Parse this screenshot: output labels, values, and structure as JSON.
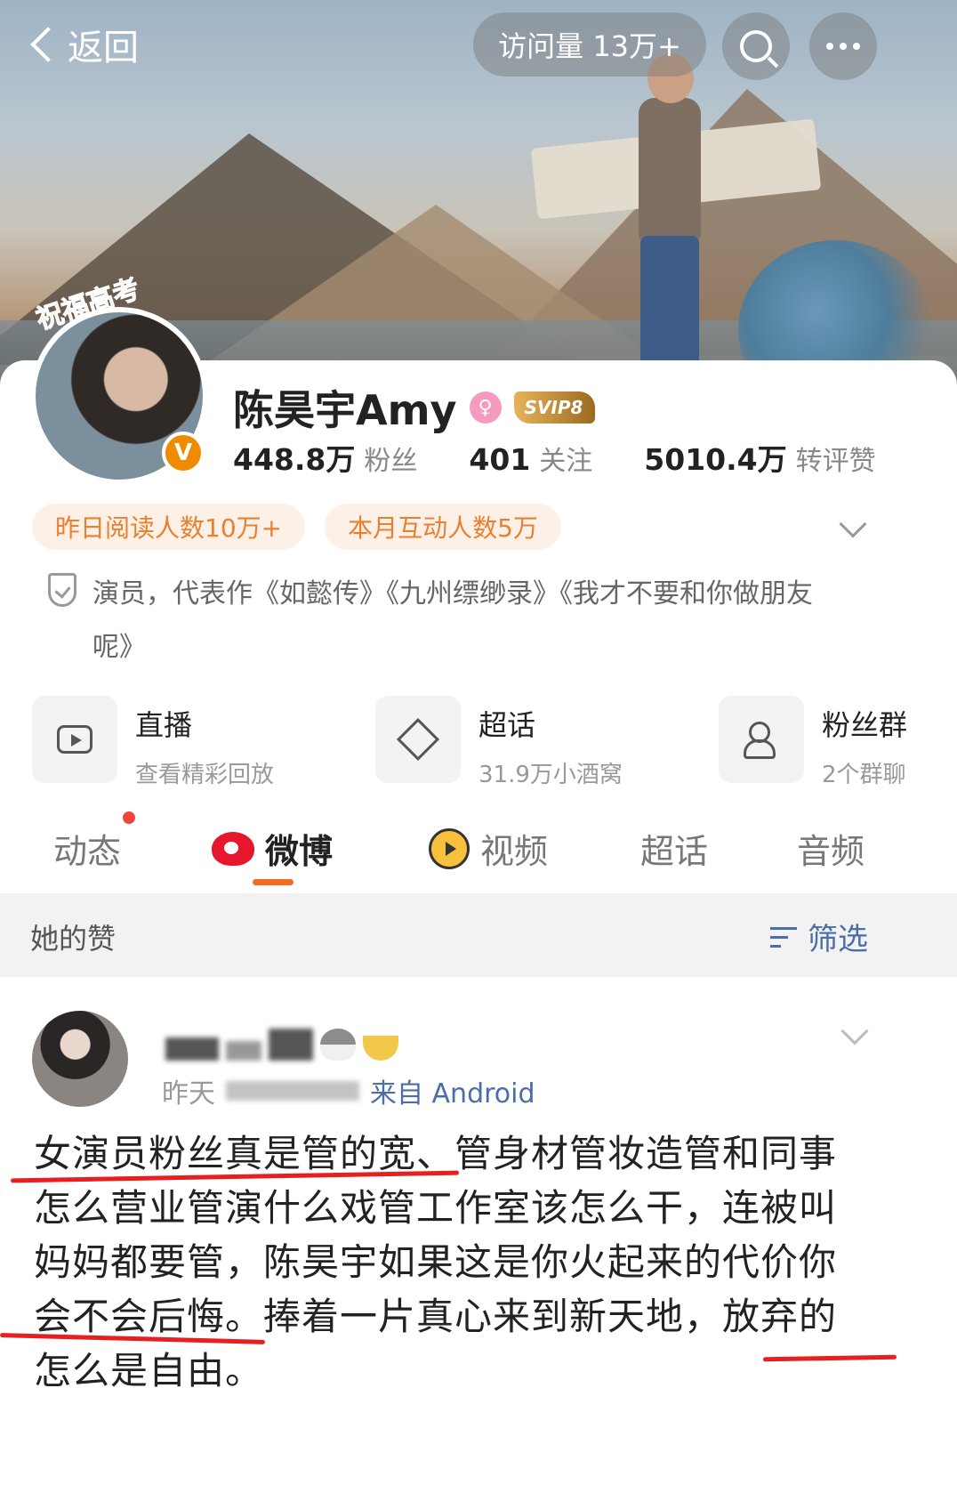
{
  "header": {
    "back_label": "返回",
    "visits": "访问量 13万+",
    "icons": [
      "chevron-left-icon",
      "search-icon",
      "more-icon"
    ]
  },
  "profile": {
    "avatar_badge": "祝福高考",
    "verified_badge": "V",
    "name": "陈昊宇Amy",
    "gender_symbol": "♀",
    "vip_badge": "SVIP8",
    "stats": [
      {
        "num": "448.8万",
        "label": "粉丝"
      },
      {
        "num": "401",
        "label": "关注"
      },
      {
        "num": "5010.4万",
        "label": "转评赞"
      }
    ],
    "tags": [
      "昨日阅读人数10万+",
      "本月互动人数5万"
    ],
    "bio": "演员，代表作《如懿传》《九州缥缈录》《我才不要和你做朋友呢》"
  },
  "entries": [
    {
      "title": "直播",
      "sub": "查看精彩回放",
      "icon": "live-tv-icon"
    },
    {
      "title": "超话",
      "sub": "31.9万小酒窝",
      "icon": "diamond-icon"
    },
    {
      "title": "粉丝群",
      "sub": "2个群聊",
      "icon": "people-icon"
    }
  ],
  "tabs": [
    {
      "label": "动态",
      "active": false,
      "dot": true
    },
    {
      "label": "微博",
      "active": true,
      "icon": "weibo-icon"
    },
    {
      "label": "视频",
      "active": false,
      "icon": "video-icon"
    },
    {
      "label": "超话",
      "active": false
    },
    {
      "label": "音频",
      "active": false
    }
  ],
  "filter_bar": {
    "label": "她的赞",
    "filter_label": "筛选"
  },
  "post": {
    "time": "昨天",
    "source": "来自 Android",
    "lines": [
      "女演员粉丝真是管的宽、管身材管妆造管和同事",
      "怎么营业管演什么戏管工作室该怎么干，连被叫",
      "妈妈都要管，陈昊宇如果这是你火起来的代价你",
      "会不会后悔。捧着一片真心来到新天地，放弃的",
      "怎么是自由。"
    ]
  },
  "colors": {
    "accent": "#f26d20",
    "link": "#4b6ea8",
    "tag_bg": "#fdf1e7",
    "tag_text": "#e9802f",
    "annotation": "#e62020"
  }
}
